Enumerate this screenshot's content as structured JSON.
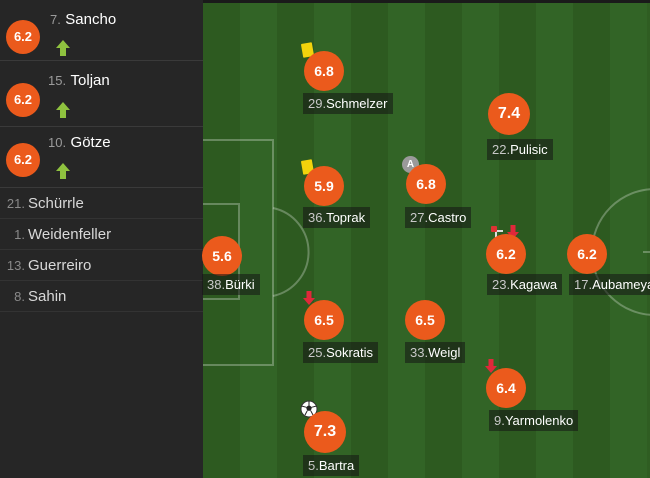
{
  "substitutes": [
    {
      "rating": "6.2",
      "number": "7.",
      "name": "Sancho"
    },
    {
      "rating": "6.2",
      "number": "15.",
      "name": "Toljan"
    },
    {
      "rating": "6.2",
      "number": "10.",
      "name": "Götze"
    }
  ],
  "bench": [
    {
      "number": "21.",
      "name": "Schürrle"
    },
    {
      "number": "1.",
      "name": "Weidenfeller"
    },
    {
      "number": "13.",
      "name": "Guerreiro"
    },
    {
      "number": "8.",
      "name": "Sahin"
    }
  ],
  "players": {
    "schmelzer": {
      "rating": "6.8",
      "number": "29.",
      "name": "Schmelzer"
    },
    "pulisic": {
      "rating": "7.4",
      "number": "22.",
      "name": "Pulisic"
    },
    "toprak": {
      "rating": "5.9",
      "number": "36.",
      "name": "Toprak"
    },
    "castro": {
      "rating": "6.8",
      "number": "27.",
      "name": "Castro"
    },
    "burki": {
      "rating": "5.6",
      "number": "38.",
      "name": "Bürki"
    },
    "kagawa": {
      "rating": "6.2",
      "number": "23.",
      "name": "Kagawa"
    },
    "aubameyang": {
      "rating": "6.2",
      "number": "17.",
      "name": "Aubameyang"
    },
    "sokratis": {
      "rating": "6.5",
      "number": "25.",
      "name": "Sokratis"
    },
    "weigl": {
      "rating": "6.5",
      "number": "33.",
      "name": "Weigl"
    },
    "yarmolenko": {
      "rating": "6.4",
      "number": "9.",
      "name": "Yarmolenko"
    },
    "bartra": {
      "rating": "7.3",
      "number": "5.",
      "name": "Bartra"
    }
  },
  "captain_badge": "A",
  "colors": {
    "rating": "#eb5a1c",
    "card": "#f2d30c",
    "sub_in": "#8fc23f",
    "sub_out": "#e0283a",
    "pitch": "#2f5d22"
  }
}
